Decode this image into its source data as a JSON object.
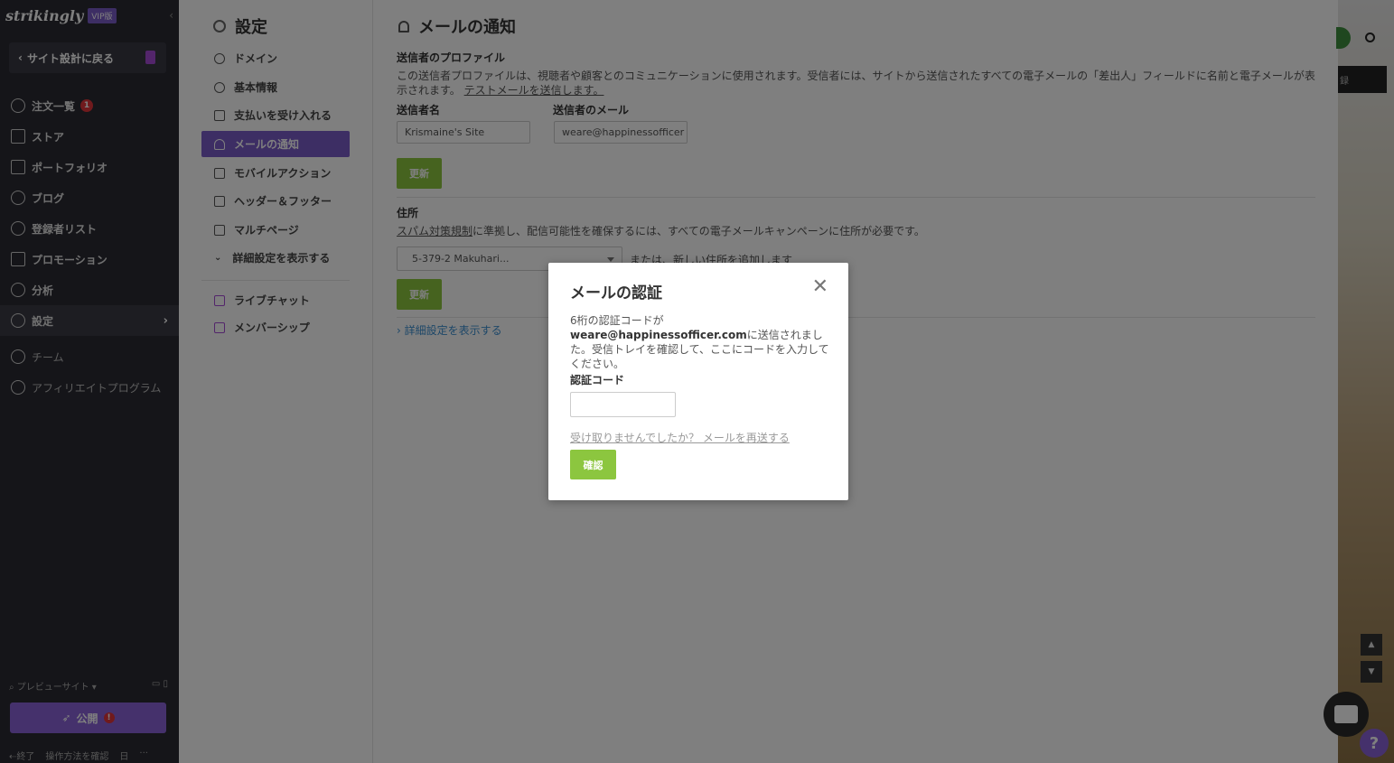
{
  "app": {
    "logo": "strikingly",
    "vip_badge": "VIP版",
    "back_label": "サイト設計に戻る"
  },
  "nav": {
    "orders": "注文一覧",
    "orders_badge": "1",
    "store": "ストア",
    "portfolio": "ポートフォリオ",
    "blog": "ブログ",
    "subscribers": "登録者リスト",
    "promotion": "プロモーション",
    "analytics": "分析",
    "settings": "設定",
    "team": "チーム",
    "affiliate": "アフィリエイトプログラム"
  },
  "bottom": {
    "preview": "プレビューサイト",
    "publish": "公開",
    "publish_warn": "!",
    "exit": "終了",
    "howto": "操作方法を確認",
    "lang": "日",
    "more": "···"
  },
  "settings_menu": {
    "title": "設定",
    "items": [
      "ドメイン",
      "基本情報",
      "支払いを受け入れる",
      "メールの通知",
      "モバイルアクション",
      "ヘッダー＆フッター",
      "マルチページ",
      "詳細設定を表示する"
    ],
    "live_chat": "ライブチャット",
    "membership": "メンバーシップ"
  },
  "main": {
    "title": "メールの通知",
    "sender_profile_heading": "送信者のプロファイル",
    "sender_profile_desc": "この送信者プロファイルは、視聴者や顧客とのコミュニケーションに使用されます。受信者には、サイトから送信されたすべての電子メールの「差出人」フィールドに名前と電子メールが表示されます。",
    "test_mail_link": "テストメールを送信します。",
    "sender_name_label": "送信者名",
    "sender_name_value": "Krismaine's Site",
    "sender_email_label": "送信者のメール",
    "sender_email_value": "weare@happinessofficer",
    "update_label": "更新",
    "address_heading": "住所",
    "spam_link": "スパム対策規制",
    "address_desc": "に準拠し、配信可能性を確保するには、すべての電子メールキャンペーンに住所が必要です。",
    "address_select": "5-379-2 Makuhari...",
    "or_add_address": "または、新しい住所を追加します",
    "advanced_link": "詳細設定を表示する"
  },
  "right_strip": {
    "button_text": "録"
  },
  "modal": {
    "title": "メールの認証",
    "msg_pre": "6桁の認証コードが",
    "msg_email": "weare@happinessofficer.com",
    "msg_post": "に送信されました。受信トレイを確認して、ここにコードを入力してください。",
    "code_label": "認証コード",
    "code_value": "",
    "resend_link": "受け取りませんでしたか？ メールを再送する",
    "confirm_label": "確認"
  }
}
